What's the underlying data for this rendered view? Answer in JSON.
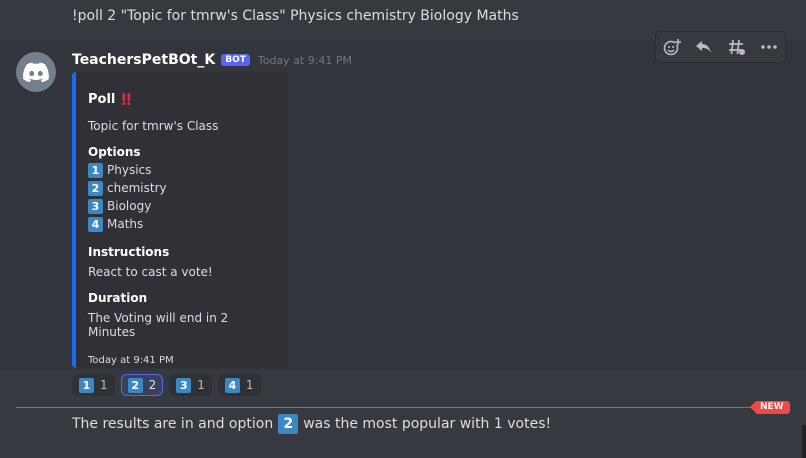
{
  "command": {
    "text": "!poll 2 \"Topic for tmrw's Class\" Physics chemistry Biology Maths"
  },
  "message": {
    "username": "TeachersPetBOt_K",
    "bot_tag": "BOT",
    "timestamp": "Today at 9:41 PM",
    "avatar_icon": "discord-logo-icon"
  },
  "toolbar": {
    "icons": [
      "add-reaction-icon",
      "reply-icon",
      "create-thread-icon",
      "more-icon"
    ]
  },
  "embed": {
    "title": "Poll",
    "title_emoji": "‼",
    "description": "Topic for tmrw's Class",
    "options_label": "Options",
    "options": [
      {
        "num": "1",
        "label": "Physics"
      },
      {
        "num": "2",
        "label": "chemistry"
      },
      {
        "num": "3",
        "label": "Biology"
      },
      {
        "num": "4",
        "label": "Maths"
      }
    ],
    "instructions_label": "Instructions",
    "instructions_value": "React to cast a vote!",
    "duration_label": "Duration",
    "duration_value": "The Voting will end in 2 Minutes",
    "footer_timestamp": "Today at 9:41 PM",
    "accent_color": "#1b6bf0"
  },
  "reactions": [
    {
      "emoji": "1",
      "count": "1",
      "me": false
    },
    {
      "emoji": "2",
      "count": "2",
      "me": true
    },
    {
      "emoji": "3",
      "count": "1",
      "me": false
    },
    {
      "emoji": "4",
      "count": "1",
      "me": false
    }
  ],
  "new_divider": {
    "label": "NEW",
    "color": "#f04747"
  },
  "result": {
    "prefix": "The results are in and option",
    "option": "2",
    "suffix": "was the most popular with 1 votes!"
  }
}
